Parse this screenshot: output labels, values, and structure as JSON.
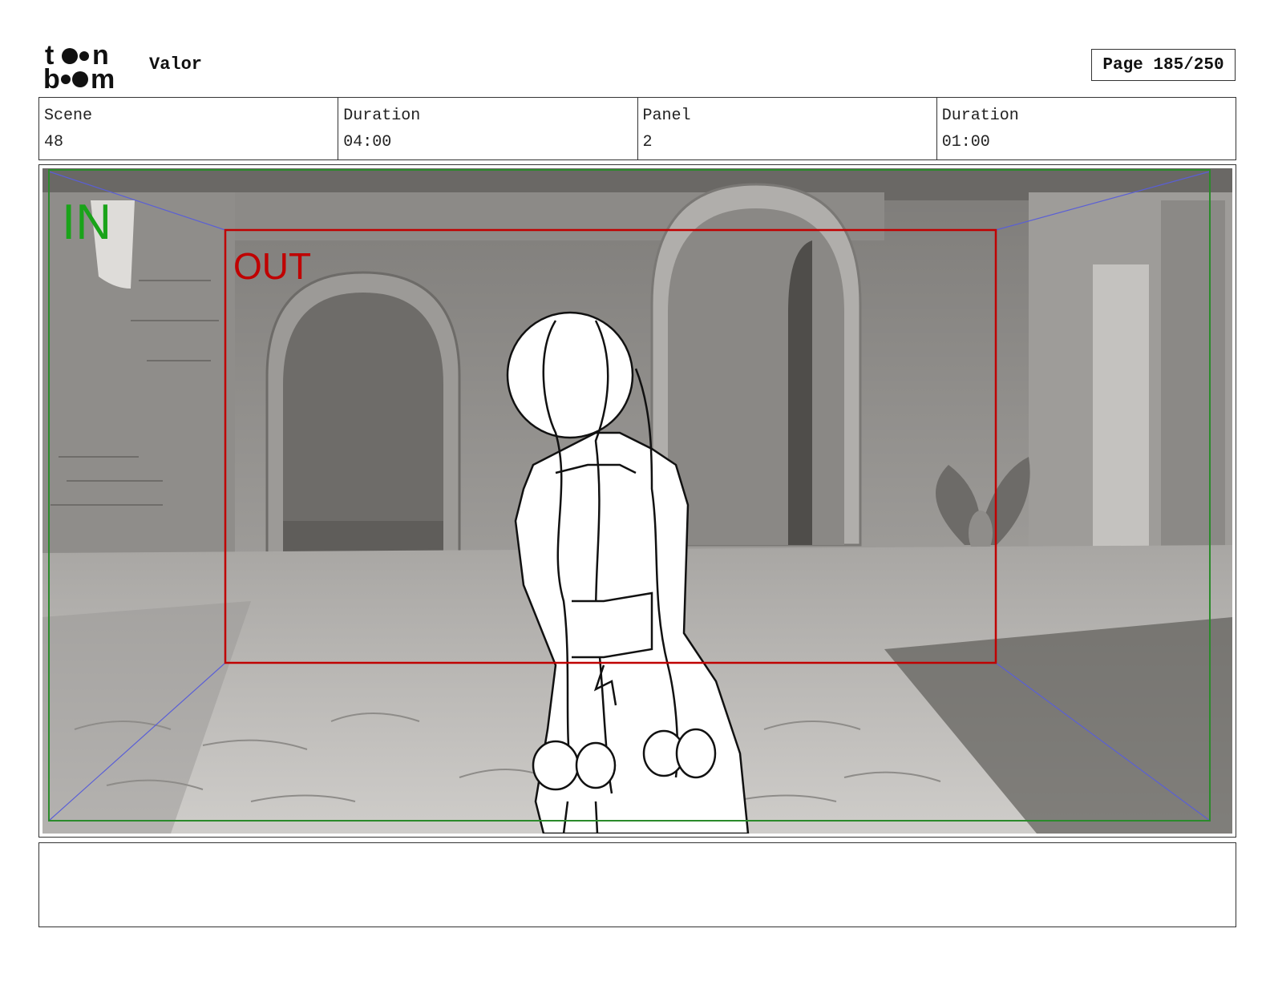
{
  "header": {
    "logo_text": "toon boom",
    "project_title": "Valor",
    "page_label": "Page 185/250"
  },
  "info": {
    "scene_label": "Scene",
    "scene_value": "48",
    "scene_duration_label": "Duration",
    "scene_duration_value": "04:00",
    "panel_label": "Panel",
    "panel_value": "2",
    "panel_duration_label": "Duration",
    "panel_duration_value": "01:00"
  },
  "panel": {
    "in_label": "IN",
    "out_label": "OUT",
    "in_color": "#1aa31a",
    "out_color": "#c00000",
    "guide_color": "#5a5fd6"
  },
  "notes": {
    "text": ""
  }
}
